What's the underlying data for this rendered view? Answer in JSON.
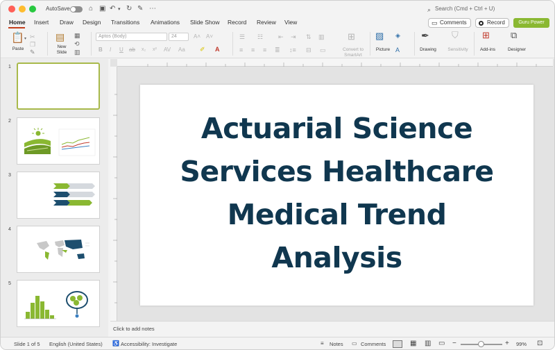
{
  "titlebar": {
    "autosave_label": "AutoSave",
    "search_placeholder": "Search (Cmd + Ctrl + U)",
    "light_colors": [
      "#ff5f57",
      "#febc2e",
      "#28c840"
    ]
  },
  "tabs": [
    "Home",
    "Insert",
    "Draw",
    "Design",
    "Transitions",
    "Animations",
    "Slide Show",
    "Record",
    "Review",
    "View"
  ],
  "actions": {
    "comments_label": "Comments",
    "record_label": "Record",
    "guru_label": "Guru Power"
  },
  "ribbon": {
    "paste_label": "Paste",
    "new_slide_label": "New\nSlide",
    "font_name": "Aptos (Body)",
    "font_size": "24",
    "convert_label": "Convert to\nSmartArt",
    "picture_label": "Picture",
    "drawing_label": "Drawing",
    "sensitivity_label": "Sensitivity",
    "addins_label": "Add-ins",
    "designer_label": "Designer"
  },
  "slides": [
    {
      "number": "1"
    },
    {
      "number": "2"
    },
    {
      "number": "3"
    },
    {
      "number": "4"
    },
    {
      "number": "5"
    }
  ],
  "slide": {
    "title_lines": [
      "Actuarial Science",
      "Services Healthcare",
      "Medical Trend",
      "Analysis"
    ],
    "title_color": "#10374f"
  },
  "notes_placeholder": "Click to add notes",
  "status": {
    "slide_info": "Slide 1 of 5",
    "language": "English (United States)",
    "accessibility": "Accessibility: Investigate",
    "notes_label": "Notes",
    "comments_label": "Comments",
    "zoom": "99%"
  },
  "colors": {
    "accent": "#c43e1c",
    "thumb_green": "#8ab832",
    "thumb_navy": "#1d4e6e"
  }
}
